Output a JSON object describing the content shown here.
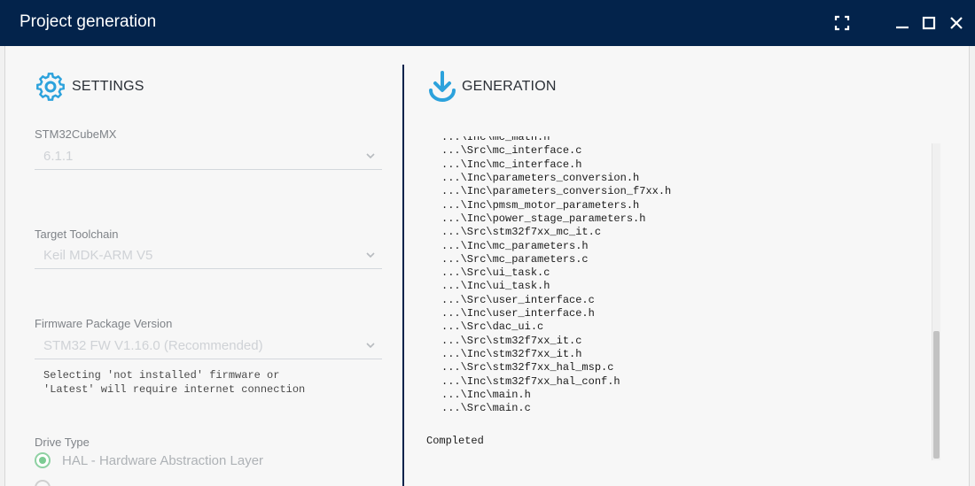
{
  "window": {
    "title": "Project generation"
  },
  "colors": {
    "titlebar": "#03234b",
    "accent": "#2ca2dc",
    "radio": "#7ccb93"
  },
  "settings": {
    "title": "SETTINGS",
    "icon": "gear-icon",
    "cubemx_label": "STM32CubeMX",
    "cubemx_value": "6.1.1",
    "toolchain_label": "Target Toolchain",
    "toolchain_value": "Keil MDK-ARM V5",
    "firmware_label": "Firmware Package Version",
    "firmware_value": "STM32 FW V1.16.0 (Recommended)",
    "firmware_note_line1": "Selecting 'not installed' firmware or",
    "firmware_note_line2": "'Latest' will require internet connection",
    "drive_label": "Drive Type",
    "drive_option": "HAL - Hardware Abstraction Layer"
  },
  "generation": {
    "title": "GENERATION",
    "icon": "download-icon",
    "log_lines": [
      "...\\Inc\\mc_math.h",
      "...\\Src\\mc_interface.c",
      "...\\Inc\\mc_interface.h",
      "...\\Inc\\parameters_conversion.h",
      "...\\Inc\\parameters_conversion_f7xx.h",
      "...\\Inc\\pmsm_motor_parameters.h",
      "...\\Inc\\power_stage_parameters.h",
      "...\\Src\\stm32f7xx_mc_it.c",
      "...\\Inc\\mc_parameters.h",
      "...\\Src\\mc_parameters.c",
      "...\\Src\\ui_task.c",
      "...\\Inc\\ui_task.h",
      "...\\Src\\user_interface.c",
      "...\\Inc\\user_interface.h",
      "...\\Src\\dac_ui.c",
      "...\\Src\\stm32f7xx_it.c",
      "...\\Inc\\stm32f7xx_it.h",
      "...\\Src\\stm32f7xx_hal_msp.c",
      "...\\Inc\\stm32f7xx_hal_conf.h",
      "...\\Inc\\main.h",
      "...\\Src\\main.c"
    ],
    "status": "Completed"
  }
}
